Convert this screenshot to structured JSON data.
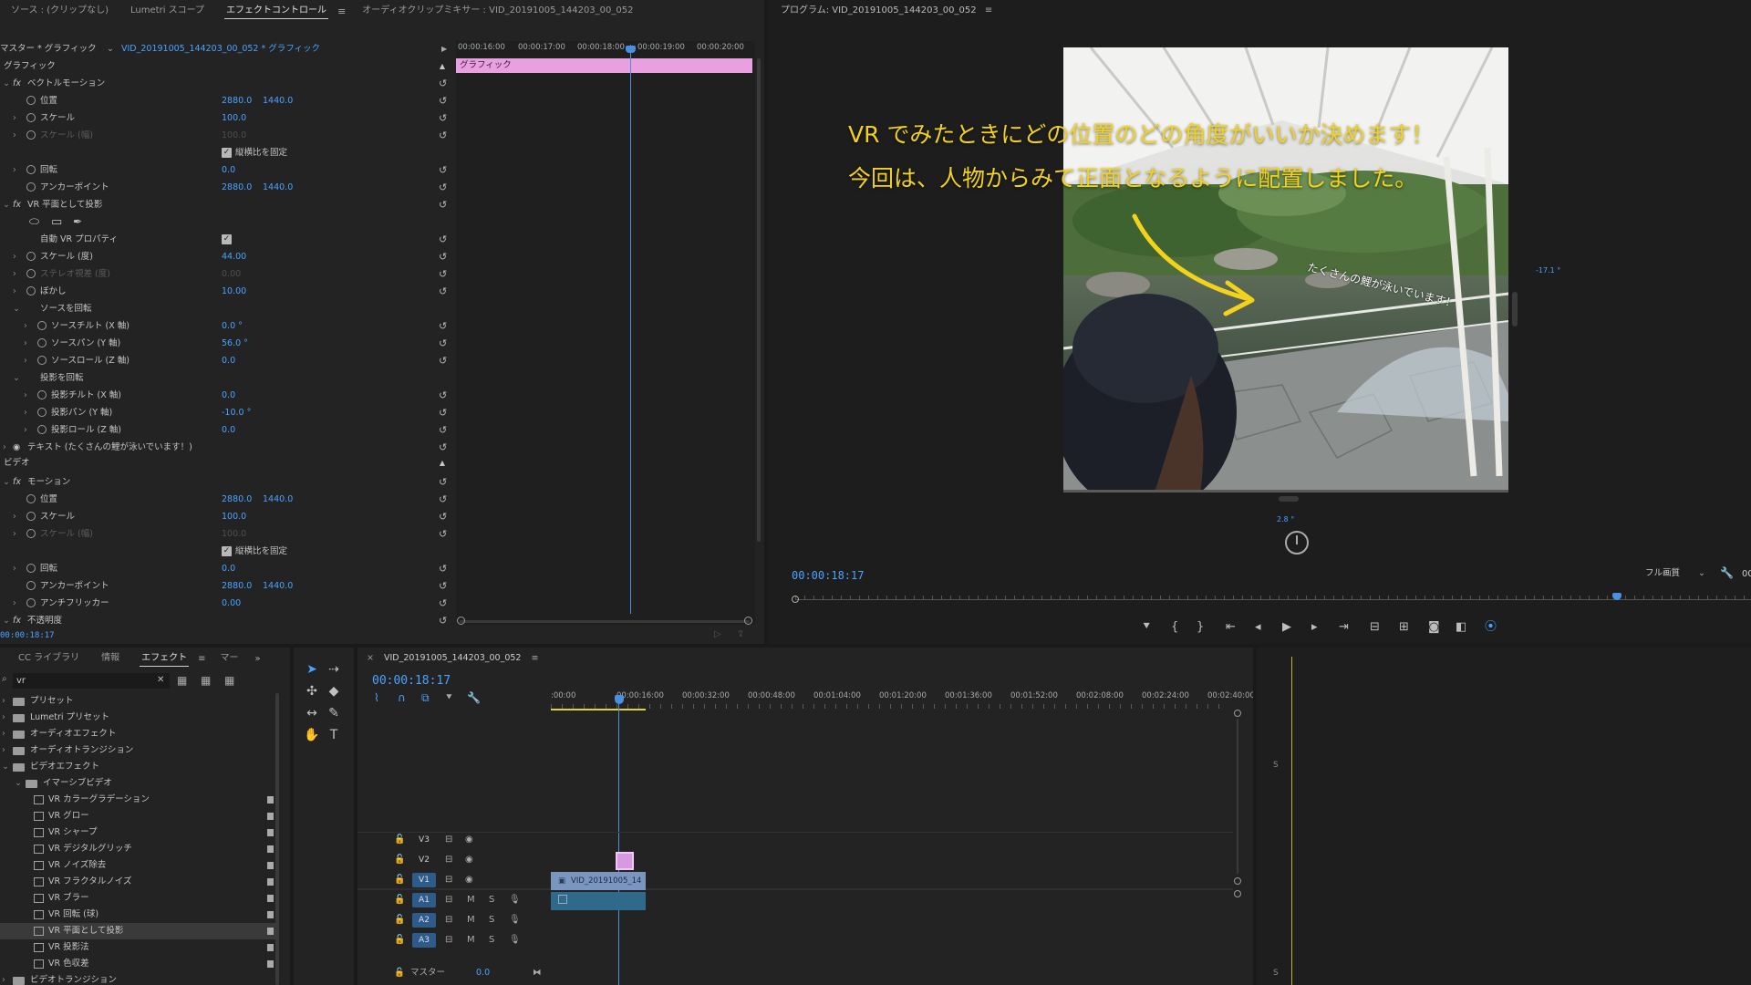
{
  "source_panel": {
    "tabs": [
      "ソース : (クリップなし)",
      "Lumetri スコープ",
      "エフェクトコントロール",
      "オーディオクリップミキサー : VID_20191005_144203_00_052"
    ],
    "menu_icon": "hamburger-icon",
    "master_label": "マスター * グラフィック",
    "clip_label": "VID_20191005_144203_00_052 * グラフィック",
    "ruler": [
      "00:00:16:00",
      "00:00:17:00",
      "00:00:18:00",
      "00:00:19:00",
      "00:00:20:00"
    ],
    "clip_bar_label": "グラフィック",
    "section_graphic": "グラフィック",
    "section_video": "ビデオ",
    "timecode": "00:00:18:17",
    "rows": [
      {
        "type": "group",
        "label": "ベクトルモーション",
        "fx": true
      },
      {
        "label": "位置",
        "v1": "2880.0",
        "v2": "1440.0",
        "sw": true
      },
      {
        "label": "スケール",
        "v1": "100.0",
        "sw": true,
        "tw": true
      },
      {
        "label": "スケール (幅)",
        "v1": "100.0",
        "sw": true,
        "tw": true,
        "dim": true
      },
      {
        "type": "check",
        "label": "縦横比を固定"
      },
      {
        "label": "回転",
        "v1": "0.0",
        "sw": true,
        "tw": true
      },
      {
        "label": "アンカーポイント",
        "v1": "2880.0",
        "v2": "1440.0",
        "sw": true
      },
      {
        "type": "group",
        "label": "VR 平面として投影",
        "fx": true
      },
      {
        "type": "masks"
      },
      {
        "type": "check",
        "label": "自動 VR プロパティ",
        "plain": true
      },
      {
        "label": "スケール (度)",
        "v1": "44.00",
        "sw": true,
        "tw": true
      },
      {
        "label": "ステレオ視差 (度)",
        "v1": "0.00",
        "sw": true,
        "tw": true,
        "dim": true
      },
      {
        "label": "ぼかし",
        "v1": "10.00",
        "sw": true,
        "tw": true
      },
      {
        "type": "sub",
        "label": "ソースを回転"
      },
      {
        "label": "ソースチルト (X 軸)",
        "v1": "0.0 °",
        "sw": true,
        "tw": true,
        "indent": true
      },
      {
        "label": "ソースパン (Y 軸)",
        "v1": "56.0 °",
        "sw": true,
        "tw": true,
        "indent": true
      },
      {
        "label": "ソースロール (Z 軸)",
        "v1": "0.0",
        "sw": true,
        "tw": true,
        "indent": true
      },
      {
        "type": "sub",
        "label": "投影を回転"
      },
      {
        "label": "投影チルト (X 軸)",
        "v1": "0.0",
        "sw": true,
        "tw": true,
        "indent": true
      },
      {
        "label": "投影パン (Y 軸)",
        "v1": "-10.0 °",
        "sw": true,
        "tw": true,
        "indent": true
      },
      {
        "label": "投影ロール (Z 軸)",
        "v1": "0.0",
        "sw": true,
        "tw": true,
        "indent": true
      },
      {
        "type": "text",
        "label": "テキスト (たくさんの鯉が泳いでいます！)"
      },
      {
        "type": "section",
        "label": "ビデオ"
      },
      {
        "type": "group",
        "label": "モーション",
        "fx": true
      },
      {
        "label": "位置",
        "v1": "2880.0",
        "v2": "1440.0",
        "sw": true
      },
      {
        "label": "スケール",
        "v1": "100.0",
        "sw": true,
        "tw": true
      },
      {
        "label": "スケール (幅)",
        "v1": "100.0",
        "sw": true,
        "tw": true,
        "dim": true
      },
      {
        "type": "check",
        "label": "縦横比を固定"
      },
      {
        "label": "回転",
        "v1": "0.0",
        "sw": true,
        "tw": true
      },
      {
        "label": "アンカーポイント",
        "v1": "2880.0",
        "v2": "1440.0",
        "sw": true
      },
      {
        "label": "アンチフリッカー",
        "v1": "0.00",
        "sw": true,
        "tw": true
      },
      {
        "type": "group",
        "label": "不透明度",
        "fx": true
      }
    ]
  },
  "program_monitor": {
    "title": "プログラム: VID_20191005_144203_00_052",
    "caption_line1": "VR でみたときにどの位置のどの角度がいいか決めます！",
    "caption_line2": "今回は、人物からみて正面となるように配置しました。",
    "overlay_text": "たくさんの鯉が泳いでいます！",
    "angle_right": "-17.1 °",
    "angle_bottom": "2.8 °",
    "timecode": "00:00:18:17",
    "quality": "フル画質",
    "right_cut": "00",
    "colors": {
      "caption": "#f2d21b",
      "accent": "#4aa3ff"
    },
    "buttons": [
      "marker-icon",
      "in-point-icon",
      "out-point-icon",
      "go-to-in-icon",
      "step-back-icon",
      "play-icon",
      "step-forward-icon",
      "go-to-out-icon",
      "insert-icon",
      "overwrite-icon",
      "camera-icon",
      "compare-icon",
      "vr-toggle-icon"
    ]
  },
  "project_panel": {
    "tabs": [
      "CC ライブラリ",
      "情報",
      "エフェクト",
      "マー"
    ],
    "search_value": "vr",
    "tree": [
      {
        "label": "プリセット",
        "level": 0,
        "kind": "folder"
      },
      {
        "label": "Lumetri プリセット",
        "level": 0,
        "kind": "folder"
      },
      {
        "label": "オーディオエフェクト",
        "level": 0,
        "kind": "folder"
      },
      {
        "label": "オーディオトランジション",
        "level": 0,
        "kind": "folder"
      },
      {
        "label": "ビデオエフェクト",
        "level": 0,
        "kind": "folder",
        "open": true
      },
      {
        "label": "イマーシブビデオ",
        "level": 1,
        "kind": "folder",
        "open": true
      },
      {
        "label": "VR カラーグラデーション",
        "level": 2,
        "kind": "fx"
      },
      {
        "label": "VR グロー",
        "level": 2,
        "kind": "fx"
      },
      {
        "label": "VR シャープ",
        "level": 2,
        "kind": "fx"
      },
      {
        "label": "VR デジタルグリッチ",
        "level": 2,
        "kind": "fx"
      },
      {
        "label": "VR ノイズ除去",
        "level": 2,
        "kind": "fx"
      },
      {
        "label": "VR フラクタルノイズ",
        "level": 2,
        "kind": "fx"
      },
      {
        "label": "VR ブラー",
        "level": 2,
        "kind": "fx"
      },
      {
        "label": "VR 回転 (球)",
        "level": 2,
        "kind": "fx"
      },
      {
        "label": "VR 平面として投影",
        "level": 2,
        "kind": "fx",
        "selected": true
      },
      {
        "label": "VR 投影法",
        "level": 2,
        "kind": "fx"
      },
      {
        "label": "VR 色収差",
        "level": 2,
        "kind": "fx"
      },
      {
        "label": "ビデオトランジション",
        "level": 0,
        "kind": "folder"
      }
    ]
  },
  "timeline": {
    "tab": "VID_20191005_144203_00_052",
    "timecode": "00:00:18:17",
    "ruler": [
      ":00:00",
      "00:00:16:00",
      "00:00:32:00",
      "00:00:48:00",
      "00:01:04:00",
      "00:01:20:00",
      "00:01:36:00",
      "00:01:52:00",
      "00:02:08:00",
      "00:02:24:00",
      "00:02:40:00"
    ],
    "tracks": [
      {
        "name": "V3",
        "kind": "video"
      },
      {
        "name": "V2",
        "kind": "video"
      },
      {
        "name": "V1",
        "kind": "video",
        "active": true
      },
      {
        "name": "A1",
        "kind": "audio",
        "active": true
      },
      {
        "name": "A2",
        "kind": "audio",
        "active": true
      },
      {
        "name": "A3",
        "kind": "audio",
        "active": true
      }
    ],
    "master_label": "マスター",
    "master_value": "0.0",
    "clip_label": "VID_20191005_14",
    "m_label": "M",
    "s_label": "S"
  },
  "audio_meter": {
    "s_label": "S"
  }
}
